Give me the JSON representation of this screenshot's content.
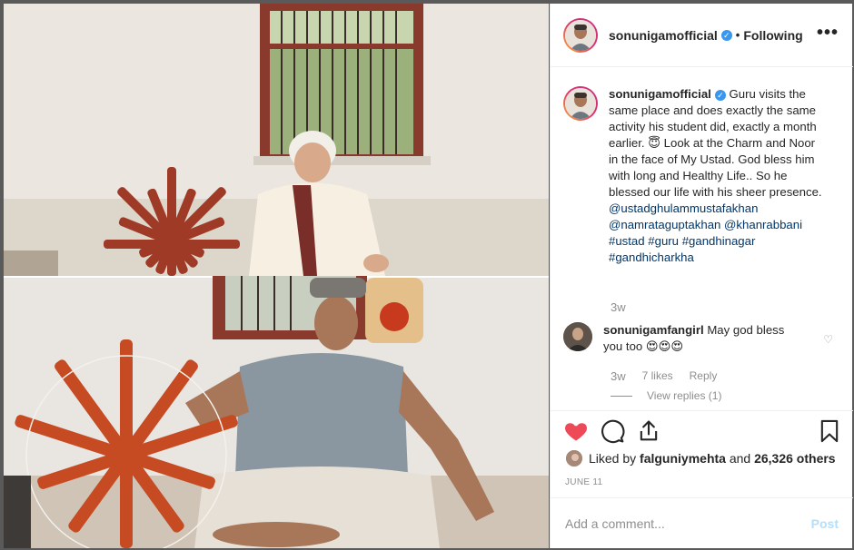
{
  "post": {
    "author": "sonunigamofficial",
    "follow_status": "Following",
    "more_icon": "more-horizontal-icon",
    "verified_icon": "verified-badge-icon"
  },
  "caption": {
    "username": "sonunigamofficial",
    "text_main": "Guru visits the same place and does exactly the same activity his student did, exactly a month earlier. 😇 Look at the Charm and Noor in the face of My Ustad. God bless him with long and Healthy Life.. So he blessed our life with his sheer presence.",
    "mentions": [
      "@ustadghulammustafakhan",
      "@namrataguptakhan",
      "@khanrabbani"
    ],
    "hashtags": [
      "#ustad",
      "#guru",
      "#gandhinagar",
      "#gandhicharkha"
    ],
    "time": "3w"
  },
  "comment": {
    "username": "sonunigamfangirl",
    "text": "May god bless you too 😍😍😍",
    "time": "3w",
    "likes": "7 likes",
    "reply": "Reply",
    "view_replies": "View replies (1)"
  },
  "actions": {
    "like_icon": "heart-filled-icon",
    "comment_icon": "comment-icon",
    "share_icon": "share-icon",
    "save_icon": "bookmark-icon",
    "like_color": "#ed4956"
  },
  "likes": {
    "prefix": "Liked by ",
    "user": "falguniymehta",
    "middle": " and ",
    "others": "26,326 others"
  },
  "date": "JUNE 11",
  "add_comment": {
    "placeholder": "Add a comment...",
    "post_label": "Post"
  }
}
